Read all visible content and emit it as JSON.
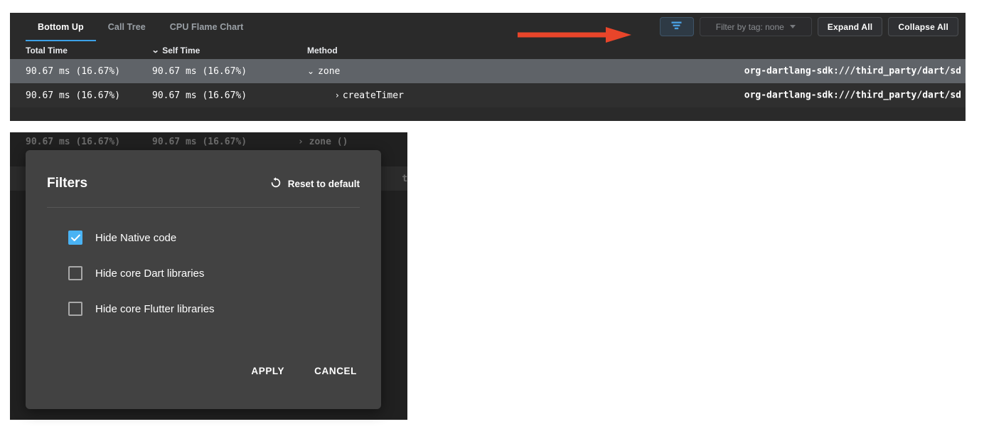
{
  "profiler": {
    "tabs": [
      {
        "label": "Bottom Up",
        "active": true
      },
      {
        "label": "Call Tree",
        "active": false
      },
      {
        "label": "CPU Flame Chart",
        "active": false
      }
    ],
    "toolbar": {
      "filter_icon": "filter-funnel-icon",
      "tag_filter_label": "Filter by tag: none",
      "expand_all_label": "Expand All",
      "collapse_all_label": "Collapse All"
    },
    "table": {
      "columns": [
        "Total Time",
        "Self Time",
        "Method"
      ],
      "sort_column": "Self Time",
      "sort_caret": "⌄",
      "rows": [
        {
          "total_time": "90.67 ms (16.67%)",
          "self_time": "90.67 ms (16.67%)",
          "twisty": "⌄",
          "method": "zone",
          "uri": "org-dartlang-sdk:///third_party/dart/sd",
          "selected": true,
          "depth": 0
        },
        {
          "total_time": "90.67 ms (16.67%)",
          "self_time": "90.67 ms (16.67%)",
          "twisty": "›",
          "method": "createTimer",
          "uri": "org-dartlang-sdk:///third_party/dart/sd",
          "selected": false,
          "depth": 1
        }
      ]
    }
  },
  "annotation": {
    "arrow_color": "#E8452A",
    "points_to": "filter-button"
  },
  "background_table": {
    "ghost_rows": [
      {
        "total_time": "90.67 ms (16.67%)",
        "self_time": "90.67 ms (16.67%)",
        "method": "› zone ()",
        "uri": ""
      },
      {
        "total_time": "",
        "self_time": "",
        "method": "›",
        "uri": "tT"
      },
      {
        "total_time": "",
        "self_time": "",
        "method": "›",
        "uri": ""
      }
    ]
  },
  "filters_dialog": {
    "title": "Filters",
    "reset_label": "Reset to default",
    "reset_icon": "rotate-left-icon",
    "checkbox_color": "#4AB3F4",
    "checkboxes": [
      {
        "label": "Hide Native code",
        "checked": true
      },
      {
        "label": "Hide core Dart libraries",
        "checked": false
      },
      {
        "label": "Hide core Flutter libraries",
        "checked": false
      }
    ],
    "apply_label": "APPLY",
    "cancel_label": "CANCEL"
  }
}
